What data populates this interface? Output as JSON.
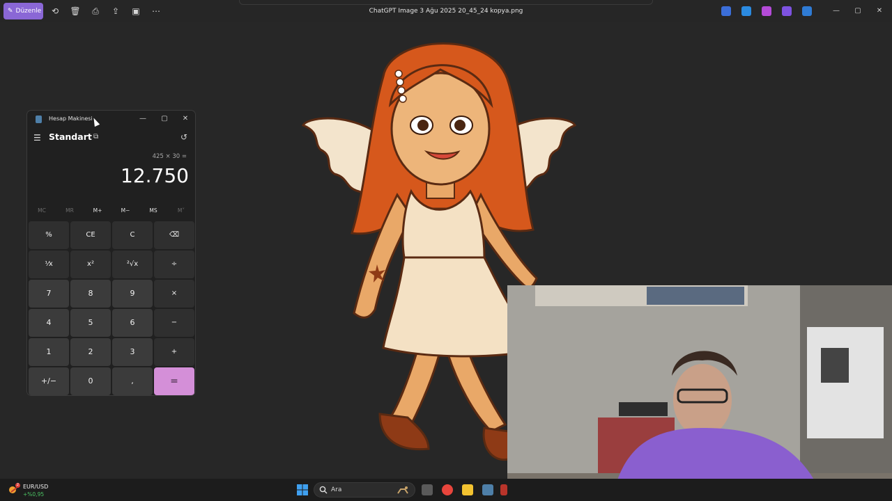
{
  "photos": {
    "edit_label": "Düzenle",
    "file_title": "ChatGPT Image 3 Ağu 2025 20_45_24 kopya.png"
  },
  "calculator": {
    "window_title": "Hesap Makinesi",
    "mode": "Standart",
    "expression": "425 × 30 =",
    "result": "12.750",
    "memory": [
      "MC",
      "MR",
      "M+",
      "M−",
      "MS",
      "M˅"
    ],
    "keys": [
      [
        "%",
        "CE",
        "C",
        "⌫"
      ],
      [
        "⅟x",
        "x²",
        "²√x",
        "÷"
      ],
      [
        "7",
        "8",
        "9",
        "×"
      ],
      [
        "4",
        "5",
        "6",
        "−"
      ],
      [
        "1",
        "2",
        "3",
        "+"
      ],
      [
        "+/−",
        "0",
        ",",
        "="
      ]
    ]
  },
  "taskbar": {
    "fx_pair": "EUR/USD",
    "fx_change": "+%0,95",
    "fx_badge": "2",
    "search_placeholder": "Ara"
  }
}
